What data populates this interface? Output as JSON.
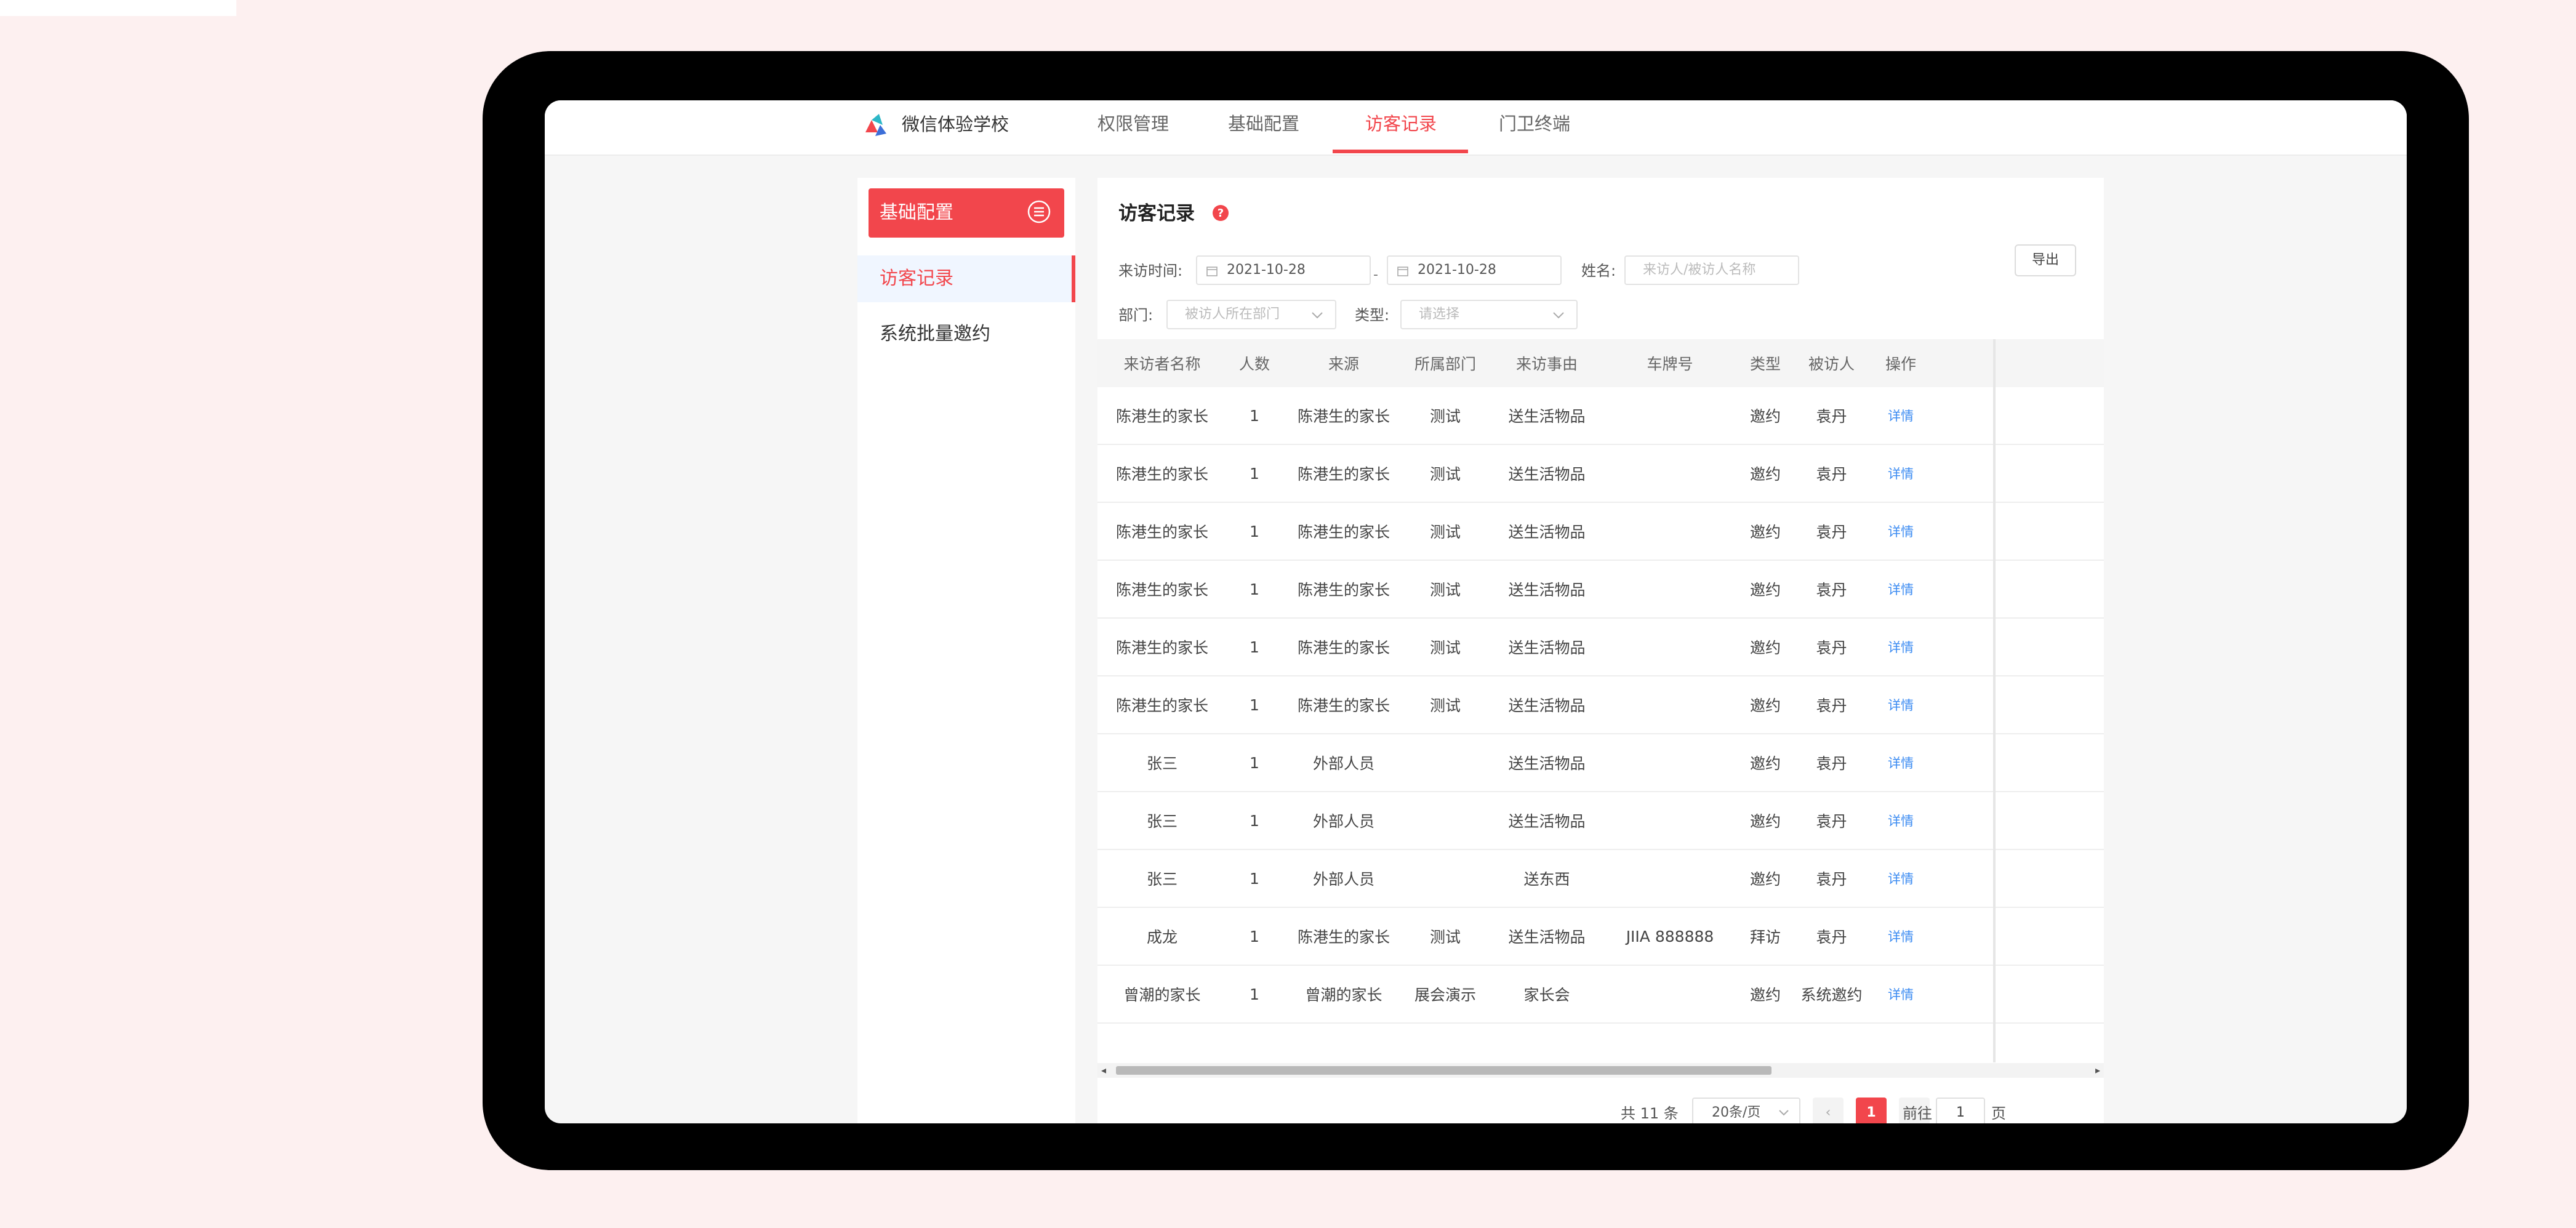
{
  "app": {
    "brand": "微信体验学校"
  },
  "nav": {
    "items": [
      {
        "label": "权限管理"
      },
      {
        "label": "基础配置"
      },
      {
        "label": "访客记录"
      },
      {
        "label": "门卫终端"
      }
    ],
    "active": "访客记录"
  },
  "sidebar": {
    "header": "基础配置",
    "items": [
      {
        "label": "访客记录",
        "active": true
      },
      {
        "label": "系统批量邀约",
        "active": false
      }
    ]
  },
  "panel": {
    "title": "访客记录",
    "filters": {
      "visit_time_label": "来访时间:",
      "date_start": "2021-10-28",
      "range_sep": "-",
      "date_end": "2021-10-28",
      "name_label": "姓名:",
      "name_placeholder": "来访人/被访人名称",
      "dept_label": "部门:",
      "dept_placeholder": "被访人所在部门",
      "type_label": "类型:",
      "type_placeholder": "请选择"
    },
    "export_label": "导出"
  },
  "table": {
    "columns": [
      "来访者名称",
      "人数",
      "来源",
      "所属部门",
      "来访事由",
      "车牌号",
      "类型",
      "被访人",
      "操作"
    ],
    "rows": [
      [
        "陈港生的家长",
        "1",
        "陈港生的家长",
        "测试",
        "送生活物品",
        "",
        "邀约",
        "袁丹",
        "详情"
      ],
      [
        "陈港生的家长",
        "1",
        "陈港生的家长",
        "测试",
        "送生活物品",
        "",
        "邀约",
        "袁丹",
        "详情"
      ],
      [
        "陈港生的家长",
        "1",
        "陈港生的家长",
        "测试",
        "送生活物品",
        "",
        "邀约",
        "袁丹",
        "详情"
      ],
      [
        "陈港生的家长",
        "1",
        "陈港生的家长",
        "测试",
        "送生活物品",
        "",
        "邀约",
        "袁丹",
        "详情"
      ],
      [
        "陈港生的家长",
        "1",
        "陈港生的家长",
        "测试",
        "送生活物品",
        "",
        "邀约",
        "袁丹",
        "详情"
      ],
      [
        "陈港生的家长",
        "1",
        "陈港生的家长",
        "测试",
        "送生活物品",
        "",
        "邀约",
        "袁丹",
        "详情"
      ],
      [
        "张三",
        "1",
        "外部人员",
        "",
        "送生活物品",
        "",
        "邀约",
        "袁丹",
        "详情"
      ],
      [
        "张三",
        "1",
        "外部人员",
        "",
        "送生活物品",
        "",
        "邀约",
        "袁丹",
        "详情"
      ],
      [
        "张三",
        "1",
        "外部人员",
        "",
        "送东西",
        "",
        "邀约",
        "袁丹",
        "详情"
      ],
      [
        "成龙",
        "1",
        "陈港生的家长",
        "测试",
        "送生活物品",
        "JIIA 888888",
        "拜访",
        "袁丹",
        "详情"
      ],
      [
        "曾潮的家长",
        "1",
        "曾潮的家长",
        "展会演示",
        "家长会",
        "",
        "邀约",
        "系统邀约",
        "详情"
      ]
    ]
  },
  "pagination": {
    "total_text": "共 11 条",
    "page_size": "20条/页",
    "prev": "‹",
    "current_page": "1",
    "next": "›",
    "goto_label": "前往",
    "goto_value": "1",
    "goto_suffix": "页"
  },
  "scrollbar": {
    "left_arrow": "◂",
    "right_arrow": "▸"
  },
  "colors": {
    "accent": "#f2464c",
    "link": "#3d8cf2",
    "device": "#000000",
    "background": "#fdf0f0"
  }
}
